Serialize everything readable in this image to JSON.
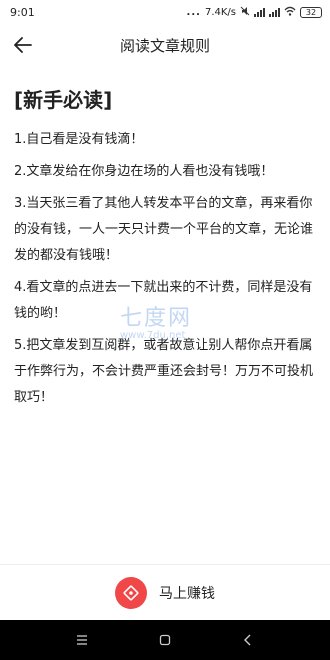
{
  "status_bar": {
    "time": "9:01",
    "dots": "...",
    "network_speed": "7.4K/s",
    "battery": "32"
  },
  "header": {
    "title": "阅读文章规则"
  },
  "content": {
    "heading": "[新手必读]",
    "rules": [
      "1.自己看是没有钱滴！",
      "2.文章发给在你身边在场的人看也没有钱哦！",
      "3.当天张三看了其他人转发本平台的文章，再来看你的没有钱，一人一天只计费一个平台的文章，无论谁发的都没有钱哦！",
      "4.看文章的点进去一下就出来的不计费，同样是没有钱的哟！",
      "5.把文章发到互阅群，或者故意让别人帮你点开看属于作弊行为，不会计费严重还会封号！万万不可投机取巧！"
    ]
  },
  "watermark": {
    "title": "七度网",
    "url": "www.7du.net"
  },
  "footer": {
    "earn_label": "马上赚钱"
  },
  "colors": {
    "accent": "#f04848",
    "nav_bar": "#000000"
  }
}
